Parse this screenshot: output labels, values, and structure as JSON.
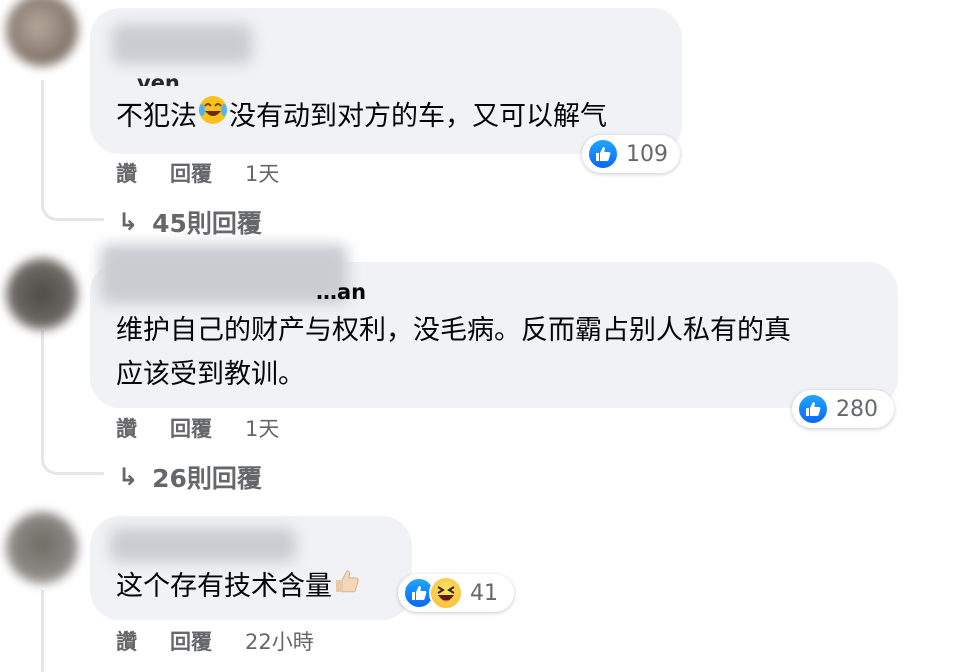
{
  "comments": [
    {
      "name": "…ven",
      "text": "不犯法😂没有动到对方的车，又可以解气",
      "text_parts": [
        "不犯法",
        "没有动到对方的车，又可以解气"
      ],
      "reaction_count": "109",
      "actions": {
        "like": "讚",
        "reply": "回覆",
        "time": "1天"
      },
      "replies": "45則回覆"
    },
    {
      "name": "…an",
      "text_lines": [
        "维护自己的财产与权利，没毛病。反而霸占别人私有的真",
        "应该受到教训。"
      ],
      "reaction_count": "280",
      "actions": {
        "like": "讚",
        "reply": "回覆",
        "time": "1天"
      },
      "replies": "26則回覆"
    },
    {
      "text": "这个存有技术含量",
      "reaction_count": "41",
      "actions": {
        "like": "讚",
        "reply": "回覆",
        "time": "22小時"
      }
    }
  ],
  "reply_arrow": "↳",
  "colors": {
    "bubble": "#f0f2f5",
    "like_blue": "#0866ff",
    "muted_text": "#65676b",
    "thread_line": "#e4e6eb"
  },
  "icons": [
    "like-icon",
    "haha-icon",
    "tears-of-joy-emoji",
    "thumbs-up-emoji",
    "reply-arrow-icon"
  ]
}
